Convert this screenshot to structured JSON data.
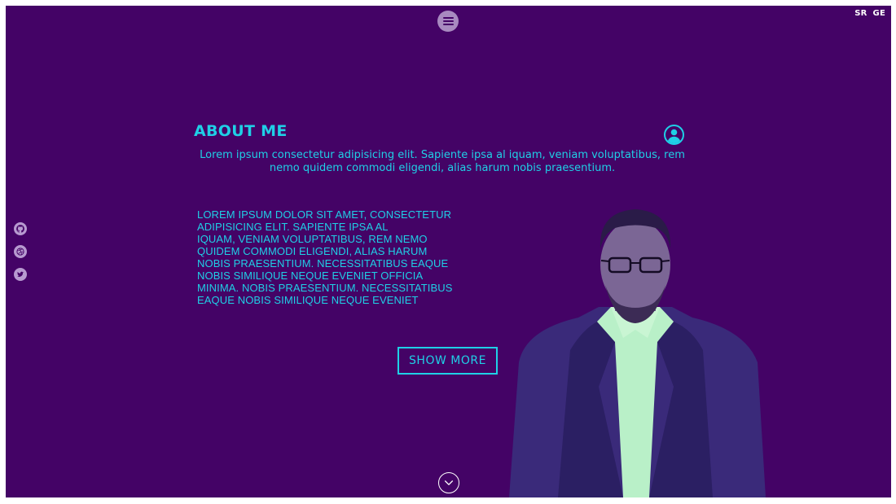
{
  "header": {
    "menu_icon": "hamburger-icon",
    "languages": [
      "SR",
      "GE"
    ]
  },
  "socials": [
    {
      "icon": "github-icon"
    },
    {
      "icon": "dribbble-icon"
    },
    {
      "icon": "twitter-icon"
    }
  ],
  "about": {
    "title": "ABOUT ME",
    "user_icon": "user-icon",
    "intro": "Lorem ipsum consectetur adipisicing elit. Sapiente ipsa al iquam, veniam voluptatibus, rem nemo quidem commodi eligendi, alias harum nobis praesentium.",
    "body_lines": [
      "LOREM IPSUM DOLOR SIT AMET, CONSECTETUR",
      "ADIPISICING ELIT. SAPIENTE IPSA AL",
      "IQUAM, VENIAM VOLUPTATIBUS, REM NEMO",
      "QUIDEM COMMODI ELIGENDI, ALIAS HARUM",
      "NOBIS PRAESENTIUM. NECESSITATIBUS EAQUE",
      "NOBIS SIMILIQUE NEQUE EVENIET OFFICIA",
      "MINIMA. NOBIS PRAESENTIUM. NECESSITATIBUS",
      "EAQUE NOBIS SIMILIQUE NEQUE EVENIET"
    ],
    "show_more_label": "SHOW MORE"
  },
  "footer": {
    "scroll_icon": "chevron-down-icon"
  },
  "colors": {
    "background": "#440366",
    "accent": "#1fd0e6",
    "muted_icon": "#b79ad0"
  }
}
